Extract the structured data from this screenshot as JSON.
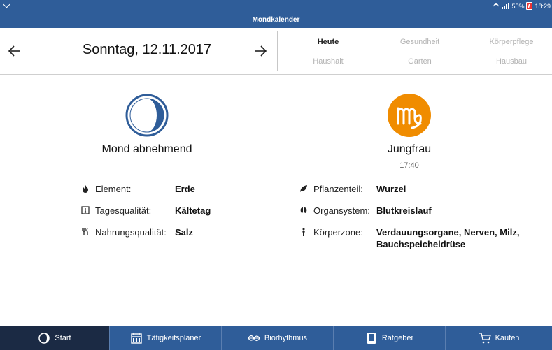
{
  "statusbar": {
    "battery": "55%",
    "time": "18:29"
  },
  "app": {
    "title": "Mondkalender"
  },
  "header": {
    "date": "Sonntag, 12.11.2017"
  },
  "categories": [
    {
      "label": "Heute",
      "active": true
    },
    {
      "label": "Gesundheit",
      "active": false
    },
    {
      "label": "Körperpflege",
      "active": false
    },
    {
      "label": "Haushalt",
      "active": false
    },
    {
      "label": "Garten",
      "active": false
    },
    {
      "label": "Hausbau",
      "active": false
    }
  ],
  "moon": {
    "phase": "Mond abnehmend",
    "rows": [
      {
        "label": "Element:",
        "value": "Erde",
        "icon": "fire-icon"
      },
      {
        "label": "Tagesqualität:",
        "value": "Kältetag",
        "icon": "thermometer-icon"
      },
      {
        "label": "Nahrungsqualität:",
        "value": "Salz",
        "icon": "cutlery-icon"
      }
    ]
  },
  "zodiac": {
    "sign": "Jungfrau",
    "time": "17:40",
    "rows": [
      {
        "label": "Pflanzenteil:",
        "value": "Wurzel",
        "icon": "leaf-icon"
      },
      {
        "label": "Organsystem:",
        "value": "Blutkreislauf",
        "icon": "organ-icon"
      },
      {
        "label": "Körperzone:",
        "value": "Verdauungsorgane, Nerven, Milz,",
        "value2": "Bauchspeicheldrüse",
        "icon": "body-icon"
      }
    ]
  },
  "tabs": [
    {
      "label": "Start",
      "icon": "moon-start-icon",
      "active": true
    },
    {
      "label": "Tätigkeitsplaner",
      "icon": "calendar-icon",
      "active": false
    },
    {
      "label": "Biorhythmus",
      "icon": "biorhythm-icon",
      "active": false
    },
    {
      "label": "Ratgeber",
      "icon": "book-icon",
      "active": false
    },
    {
      "label": "Kaufen",
      "icon": "cart-icon",
      "active": false
    }
  ],
  "colors": {
    "brand": "#2f5d99",
    "moon": "#2f5d99",
    "zodiac": "#f08c00",
    "active_tab": "#1b2a44"
  }
}
